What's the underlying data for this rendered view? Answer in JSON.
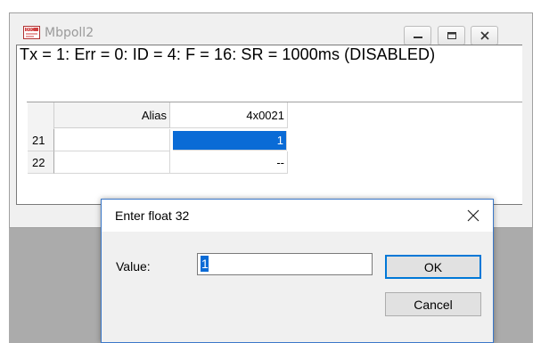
{
  "window": {
    "title": "Mbpoll2",
    "status": "Tx = 1: Err = 0: ID = 4: F = 16: SR = 1000ms  (DISABLED)"
  },
  "grid": {
    "headers": {
      "alias": "Alias",
      "register": "4x0021"
    },
    "rows": [
      {
        "num": "21",
        "alias": "",
        "value": "1",
        "selected": true
      },
      {
        "num": "22",
        "alias": "",
        "value": "--",
        "selected": false
      }
    ]
  },
  "dialog": {
    "title": "Enter float 32",
    "label": "Value:",
    "value": "1",
    "ok_label": "OK",
    "cancel_label": "Cancel"
  },
  "icons": {
    "app": "doc-icon",
    "minimize": "minimize-icon",
    "maximize": "maximize-icon",
    "close": "close-icon"
  },
  "colors": {
    "selection": "#0a6bd6",
    "dialog_border": "#3b78c9",
    "ok_border": "#0078d7"
  }
}
